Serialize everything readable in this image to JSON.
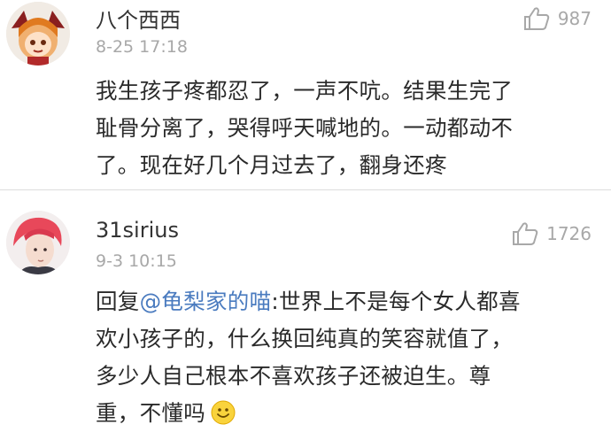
{
  "comments": [
    {
      "username": "八个西西",
      "time": "8-25 17:18",
      "likes": "987",
      "avatar_icon": "anime-girl-avatar",
      "lines": [
        "我生孩子疼都忍了，一声不吭。结果生完了",
        "耻骨分离了，哭得呼天喊地的。一动都动不",
        "了。现在好几个月过去了，翻身还疼"
      ]
    },
    {
      "username": "31sirius",
      "time": "9-3 10:15",
      "likes": "1726",
      "avatar_icon": "person-photo-avatar",
      "reply_prefix": "回复",
      "mention": "@龟梨家的喵",
      "lines": [
        ":世界上不是每个女人都喜",
        "欢小孩子的，什么换回纯真的笑容就值了，",
        "多少人自己根本不喜欢孩子还被迫生。尊",
        "重，不懂吗"
      ],
      "emoji": "smile-emoji-icon"
    }
  ],
  "colors": {
    "mention": "#4a7bbf",
    "muted": "#a8a8a8",
    "text": "#2a2a2a"
  }
}
